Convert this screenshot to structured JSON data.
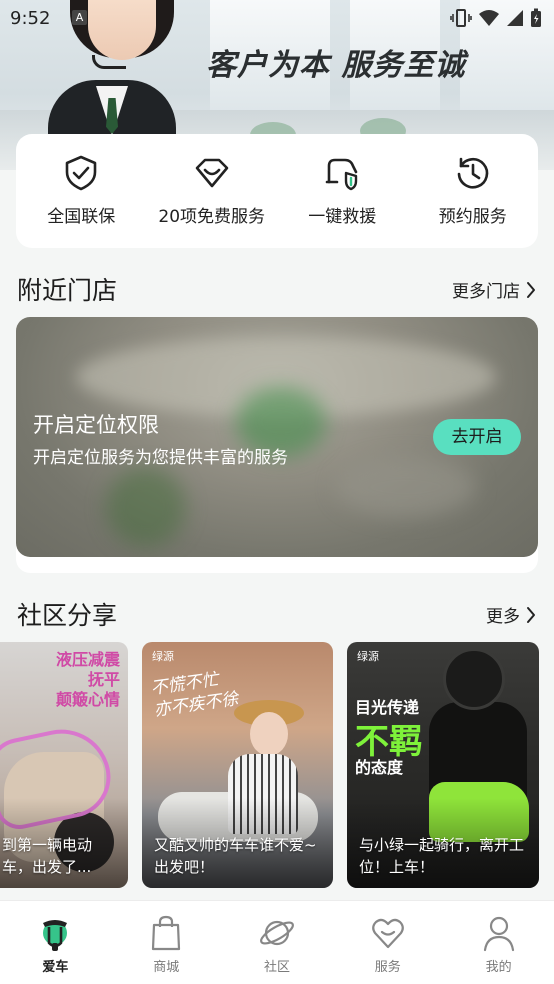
{
  "status_bar": {
    "time": "9:52",
    "input_badge": "A"
  },
  "hero": {
    "slogan": "客户为本 服务至诚"
  },
  "services": [
    {
      "label": "全国联保",
      "icon": "shield-check-icon"
    },
    {
      "label": "20项免费服务",
      "icon": "heart-badge-icon"
    },
    {
      "label": "一键救援",
      "icon": "scooter-shield-icon"
    },
    {
      "label": "预约服务",
      "icon": "clock-history-icon"
    }
  ],
  "nearby": {
    "title": "附近门店",
    "more": "更多门店",
    "location_title": "开启定位权限",
    "location_desc": "开启定位服务为您提供丰富的服务",
    "enable_button": "去开启"
  },
  "community": {
    "title": "社区分享",
    "more": "更多",
    "posts": [
      {
        "image_text": "液压减震\n抚平\n颠簸心情",
        "caption": "到第一辆电动车，出发了..."
      },
      {
        "brand": "绿源",
        "image_text": "不慌不忙\n亦不疾不徐",
        "caption": "又酷又帅的车车谁不爱~出发吧！"
      },
      {
        "brand": "绿源",
        "headline_1": "目光传递",
        "headline_2": "不羁",
        "headline_3": "的态度",
        "caption": "与小绿一起骑行，离开工位！上车！"
      }
    ]
  },
  "bottom_nav": [
    {
      "label": "爱车",
      "icon": "my-scooter-icon",
      "active": true
    },
    {
      "label": "商城",
      "icon": "shopping-bag-icon",
      "active": false
    },
    {
      "label": "社区",
      "icon": "planet-icon",
      "active": false
    },
    {
      "label": "服务",
      "icon": "heart-icon",
      "active": false
    },
    {
      "label": "我的",
      "icon": "profile-icon",
      "active": false
    }
  ],
  "colors": {
    "accent": "#59dfc0",
    "brand_green": "#36c48a",
    "active_text": "#1d1d1d",
    "inactive_text": "#7a7a7a"
  }
}
